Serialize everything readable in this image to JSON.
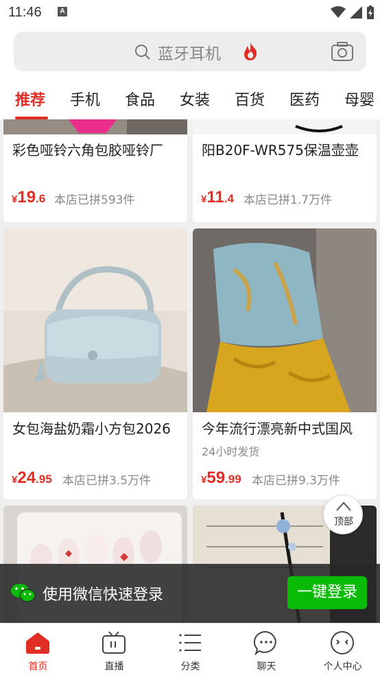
{
  "status_bar": {
    "time": "11:46",
    "notification_icon": "A"
  },
  "search": {
    "placeholder": "蓝牙耳机",
    "icons": [
      "search-icon",
      "fire-icon",
      "camera-icon"
    ]
  },
  "tabs": [
    {
      "label": "推荐",
      "active": true
    },
    {
      "label": "手机"
    },
    {
      "label": "食品"
    },
    {
      "label": "女装"
    },
    {
      "label": "百货"
    },
    {
      "label": "医药"
    },
    {
      "label": "母婴"
    }
  ],
  "products": [
    {
      "title": "彩色哑铃六角包胶哑铃厂",
      "currency": "¥",
      "price_int": "19",
      "price_dec": ".6",
      "sold": "本店已拼593件"
    },
    {
      "title": "阳B20F-WR575保温壶壶",
      "currency": "¥",
      "price_int": "11",
      "price_dec": ".4",
      "sold": "本店已拼1.7万件"
    },
    {
      "title": "女包海盐奶霜小方包2026",
      "currency": "¥",
      "price_int": "24",
      "price_dec": ".95",
      "sold": "本店已拼3.5万件"
    },
    {
      "title": "今年流行漂亮新中式国风",
      "tag": "24小时发货",
      "currency": "¥",
      "price_int": "59",
      "price_dec": ".99",
      "sold": "本店已拼9.3万件"
    }
  ],
  "back_to_top": {
    "label": "顶部"
  },
  "login_banner": {
    "text": "使用微信快速登录",
    "button": "一键登录"
  },
  "bottom_nav": [
    {
      "label": "首页",
      "icon": "home-icon",
      "active": true
    },
    {
      "label": "直播",
      "icon": "tv-icon"
    },
    {
      "label": "分类",
      "icon": "list-icon"
    },
    {
      "label": "聊天",
      "icon": "chat-icon"
    },
    {
      "label": "个人中心",
      "icon": "profile-icon"
    }
  ],
  "colors": {
    "accent": "#e02e24",
    "wechat_green": "#09bb07"
  }
}
